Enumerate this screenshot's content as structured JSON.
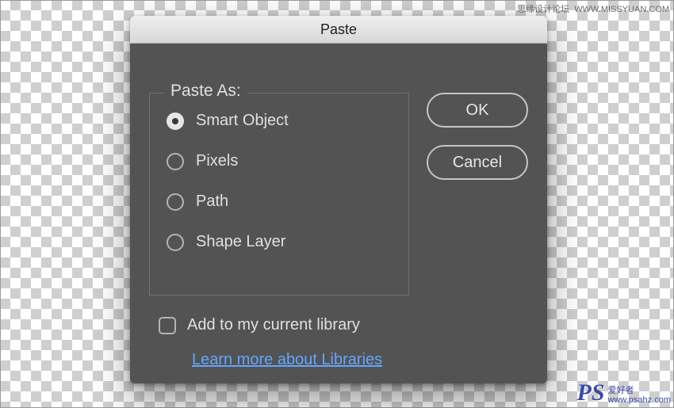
{
  "dialog": {
    "title": "Paste",
    "group_legend": "Paste As:",
    "options": [
      "Smart Object",
      "Pixels",
      "Path",
      "Shape Layer"
    ],
    "selected_index": 0,
    "checkbox_label": "Add to my current library",
    "checkbox_checked": false,
    "link_label": "Learn more about Libraries",
    "buttons": {
      "ok": "OK",
      "cancel": "Cancel"
    }
  },
  "watermark": {
    "top_right_cn": "思缘设计论坛",
    "top_right_url": "WWW.MISSYUAN.COM",
    "bottom_logo": "PS",
    "bottom_cn": "爱好者",
    "bottom_url": "www.psahz.com"
  }
}
